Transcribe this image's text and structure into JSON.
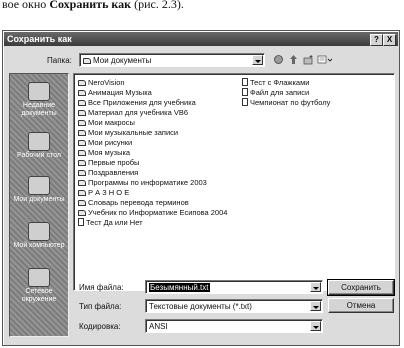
{
  "caption": {
    "prefix": "вое окно ",
    "bold": "Сохранить как",
    "suffix": " (рис. 2.3)."
  },
  "window": {
    "title": "Сохранить как",
    "help_glyph": "?",
    "close_glyph": "X"
  },
  "toolbar": {
    "folder_label": "Папка:",
    "folder_value": "Мои документы",
    "icons": [
      "back-arrow-icon",
      "up-folder-icon",
      "new-folder-icon",
      "views-menu-icon"
    ]
  },
  "places": [
    {
      "label": "Недавние документы",
      "icon": "history-icon"
    },
    {
      "label": "Рабочий стол",
      "icon": "desktop-icon"
    },
    {
      "label": "Мои документы",
      "icon": "my-documents-icon"
    },
    {
      "label": "Мой компьютер",
      "icon": "my-computer-icon"
    },
    {
      "label": "Сетевое окружение",
      "icon": "network-places-icon"
    }
  ],
  "files_col1": [
    {
      "name": "NeroVision",
      "type": "folder"
    },
    {
      "name": "Анимация Музыка",
      "type": "folder"
    },
    {
      "name": "Все Приложения для учебника",
      "type": "folder"
    },
    {
      "name": "Материал для учебника VB6",
      "type": "folder"
    },
    {
      "name": "Мои макросы",
      "type": "folder"
    },
    {
      "name": "Мои музыкальные записи",
      "type": "folder"
    },
    {
      "name": "Мои рисунки",
      "type": "folder"
    },
    {
      "name": "Моя музыка",
      "type": "folder"
    },
    {
      "name": "Первые пробы",
      "type": "folder"
    },
    {
      "name": "Поздравления",
      "type": "folder"
    },
    {
      "name": "Программы по информатике 2003",
      "type": "folder"
    },
    {
      "name": "Р А З Н О Е",
      "type": "folder"
    },
    {
      "name": "Словарь перевода терминов",
      "type": "folder"
    },
    {
      "name": "Учебник по Информатике Есипова 2004",
      "type": "folder"
    },
    {
      "name": "Тест Да или Нет",
      "type": "file"
    }
  ],
  "files_col2": [
    {
      "name": "Тест с Флажками",
      "type": "file"
    },
    {
      "name": "Файл для записи",
      "type": "file"
    },
    {
      "name": "Чемпионат по футболу",
      "type": "file"
    }
  ],
  "form": {
    "filename_label": "Имя файла:",
    "filename_value": "Безымянный.txt",
    "filetype_label": "Тип файла:",
    "filetype_value": "Текстовые документы (*.txt)",
    "encoding_label": "Кодировка:",
    "encoding_value": "ANSI"
  },
  "buttons": {
    "save": "Сохранить",
    "cancel": "Отмена"
  }
}
